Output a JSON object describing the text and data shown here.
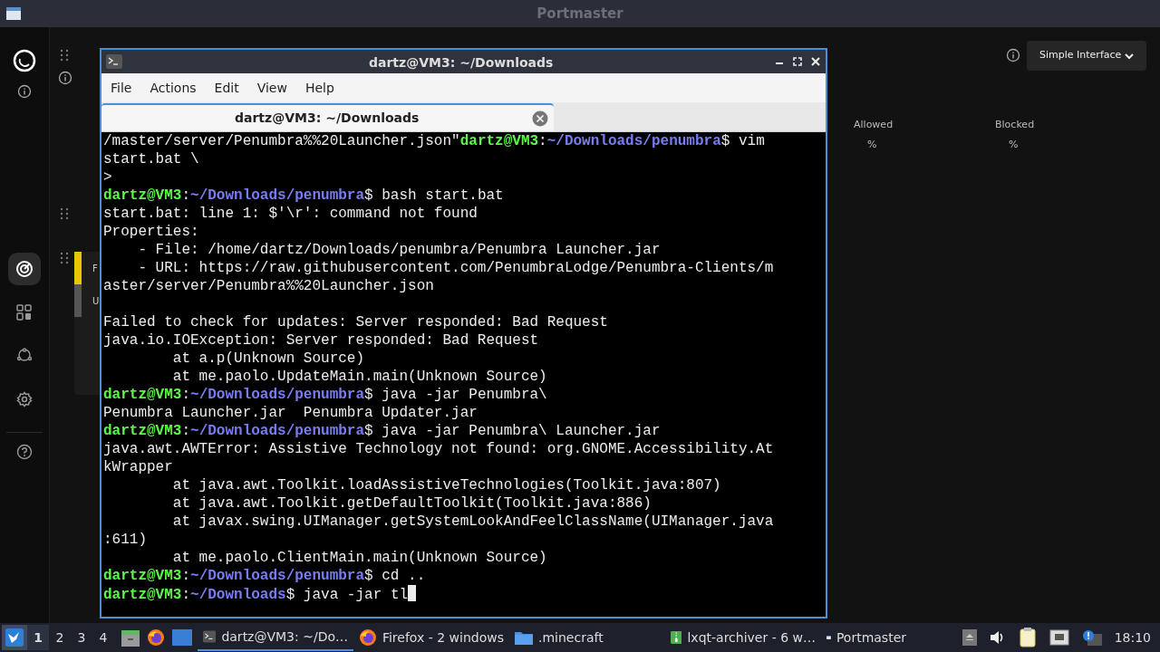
{
  "background_window": {
    "title": "Portmaster",
    "interface_mode": "Simple Interface",
    "stats": [
      {
        "label": "Allowed",
        "value": "%"
      },
      {
        "label": "Blocked",
        "value": "%"
      }
    ],
    "sidebar": [
      {
        "kind": "radar",
        "selected": true
      },
      {
        "kind": "grid",
        "selected": false
      },
      {
        "kind": "network",
        "selected": false
      },
      {
        "kind": "settings",
        "selected": false
      }
    ],
    "card_rows": [
      {
        "text": "F",
        "color": "#e5c800"
      },
      {
        "text": "U",
        "color": "#555555"
      }
    ]
  },
  "terminal": {
    "title": "dartz@VM3: ~/Downloads",
    "menu": [
      "File",
      "Actions",
      "Edit",
      "View",
      "Help"
    ],
    "tabs": [
      {
        "label": "dartz@VM3: ~/Downloads",
        "selected": true
      }
    ],
    "lines": [
      {
        "kind": "prompt",
        "before": "/master/server/Penumbra%%20Launcher.json\"",
        "user": "dartz@VM3",
        "sep": ":",
        "path": "~/Downloads/penumbra",
        "command": "$ vim"
      },
      {
        "kind": "output",
        "text": "start.bat \\"
      },
      {
        "kind": "output",
        "text": ">"
      },
      {
        "kind": "prompt",
        "user": "dartz@VM3",
        "sep": ":",
        "path": "~/Downloads/penumbra",
        "command": "$ bash start.bat"
      },
      {
        "kind": "output",
        "text": "start.bat: line 1: $'\\r': command not found"
      },
      {
        "kind": "output",
        "text": "Properties:"
      },
      {
        "kind": "output",
        "text": "    - File: /home/dartz/Downloads/penumbra/Penumbra Launcher.jar"
      },
      {
        "kind": "output",
        "text": "    - URL: https://raw.githubusercontent.com/PenumbraLodge/Penumbra-Clients/m"
      },
      {
        "kind": "output",
        "text": "aster/server/Penumbra%%20Launcher.json"
      },
      {
        "kind": "blank"
      },
      {
        "kind": "output",
        "text": "Failed to check for updates: Server responded: Bad Request"
      },
      {
        "kind": "output",
        "text": "java.io.IOException: Server responded: Bad Request"
      },
      {
        "kind": "output",
        "text": "        at a.p(Unknown Source)"
      },
      {
        "kind": "output",
        "text": "        at me.paolo.UpdateMain.main(Unknown Source)"
      },
      {
        "kind": "prompt",
        "user": "dartz@VM3",
        "sep": ":",
        "path": "~/Downloads/penumbra",
        "command": "$ java -jar Penumbra\\"
      },
      {
        "kind": "output",
        "text": "Penumbra Launcher.jar  Penumbra Updater.jar"
      },
      {
        "kind": "prompt",
        "user": "dartz@VM3",
        "sep": ":",
        "path": "~/Downloads/penumbra",
        "command": "$ java -jar Penumbra\\ Launcher.jar"
      },
      {
        "kind": "output",
        "text": "java.awt.AWTError: Assistive Technology not found: org.GNOME.Accessibility.At"
      },
      {
        "kind": "output",
        "text": "kWrapper"
      },
      {
        "kind": "output",
        "text": "        at java.awt.Toolkit.loadAssistiveTechnologies(Toolkit.java:807)"
      },
      {
        "kind": "output",
        "text": "        at java.awt.Toolkit.getDefaultToolkit(Toolkit.java:886)"
      },
      {
        "kind": "output",
        "text": "        at javax.swing.UIManager.getSystemLookAndFeelClassName(UIManager.java"
      },
      {
        "kind": "output",
        "text": ":611)"
      },
      {
        "kind": "output",
        "text": "        at me.paolo.ClientMain.main(Unknown Source)"
      },
      {
        "kind": "prompt",
        "user": "dartz@VM3",
        "sep": ":",
        "path": "~/Downloads/penumbra",
        "command": "$ cd .."
      },
      {
        "kind": "prompt",
        "user": "dartz@VM3",
        "sep": ":",
        "path": "~/Downloads",
        "command": "$ java -jar tl",
        "cursor": true
      }
    ]
  },
  "taskbar": {
    "desktops": [
      {
        "label": "1",
        "selected": true
      },
      {
        "label": "2",
        "selected": false
      },
      {
        "label": "3",
        "selected": false
      },
      {
        "label": "4",
        "selected": false
      }
    ],
    "tasks": [
      {
        "label": "dartz@VM3: ~/Do…",
        "kind": "terminal",
        "selected": true
      },
      {
        "label": "Firefox - 2 windows",
        "kind": "firefox",
        "selected": false
      },
      {
        "label": ".minecraft",
        "kind": "folder",
        "selected": false
      },
      {
        "label": "lxqt-archiver - 6 w…",
        "kind": "archive",
        "selected": false
      },
      {
        "label": "Portmaster",
        "kind": "window",
        "selected": false
      }
    ],
    "clock": "18:10"
  }
}
